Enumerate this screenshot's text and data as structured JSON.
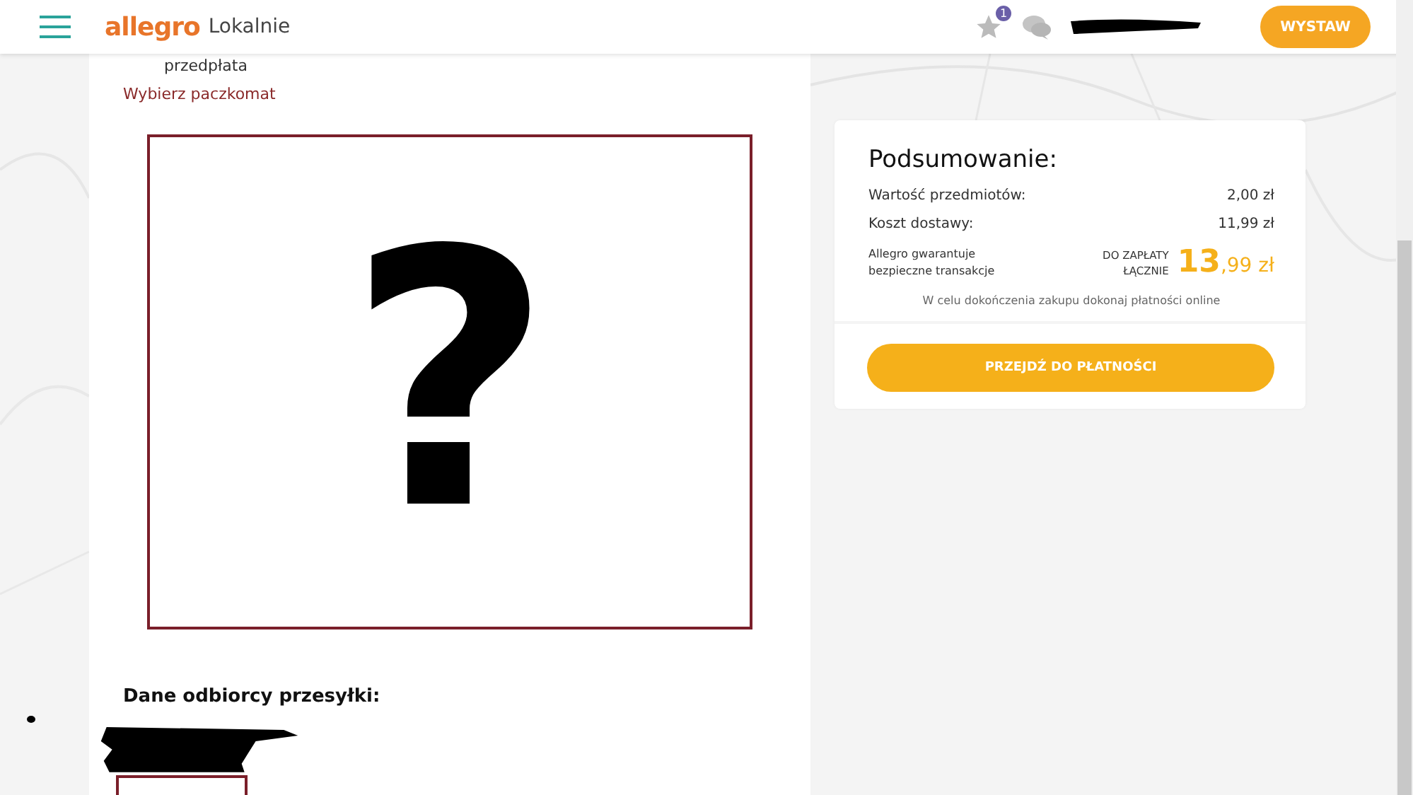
{
  "header": {
    "logo": "allegro",
    "logo_sub": "Lokalnie",
    "notification_count": "1",
    "button": "WYSTAW"
  },
  "delivery": {
    "option_label": "przedpłata",
    "link": "Wybierz paczkomat"
  },
  "image_frame": {
    "symbol": "?"
  },
  "recipient": {
    "heading": "Dane odbiorcy przesyłki:"
  },
  "summary": {
    "title": "Podsumowanie:",
    "rows": [
      {
        "label": "Wartość przedmiotów:",
        "value": "2,00 zł"
      },
      {
        "label": "Koszt dostawy:",
        "value": "11,99 zł"
      }
    ],
    "guarantee": "Allegro gwarantuje bezpieczne transakcje",
    "total_label": "DO ZAPŁATY ŁĄCZNIE",
    "total": "13,99 zł",
    "note": "W celu dokończenia zakupu dokonaj płatności online",
    "button": "PRZEJDŹ DO PŁATNOŚCI"
  }
}
